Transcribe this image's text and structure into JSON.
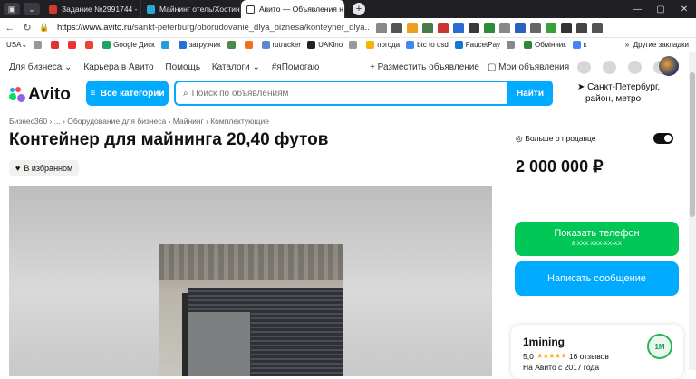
{
  "browser": {
    "tabs": [
      {
        "label": "Задание №2991744 - про",
        "color": "#d43b2a",
        "active": false
      },
      {
        "label": "Майнинг отель/Хостинг/А",
        "color": "#2aa9d4",
        "active": false
      },
      {
        "label": "Авито — Объявления н",
        "color": "#ffffff",
        "active": true
      }
    ],
    "new_tab": "+",
    "url_host": "https://www.avito.ru",
    "url_path": "/sankt-peterburg/oborudovanie_dlya_biznesa/konteyner_dlya...",
    "bookmarks": [
      "USA",
      "Google Диск",
      "загрузчик",
      "rutracker",
      "UAKino",
      "погода",
      "btc to usd",
      "FaucetPay",
      "Обмінник",
      "к"
    ],
    "bookmarks_other": "Другие закладки"
  },
  "topnav": {
    "business": "Для бизнеса",
    "career": "Карьера в Авито",
    "help": "Помощь",
    "catalogs": "Каталоги",
    "ipomogayu": "#яПомогаю",
    "post_ad": "+ Разместить объявление",
    "my_ads": "Мои объявления"
  },
  "header": {
    "logo": "Avito",
    "categories_button": "Все категории",
    "search_placeholder": "Поиск по объявлениям",
    "search_button": "Найти",
    "location_city": "Санкт-Петербург,",
    "location_sub": "район, метро"
  },
  "listing": {
    "breadcrumbs": "Бизнес360 › ... › Оборудование для бизнеса › Майнинг › Комплектующие",
    "title": "Контейнер для майнинга 20,40 футов",
    "favorite_label": "В избранном",
    "price": "2 000 000 ₽",
    "more_about_seller": "Больше о продавце",
    "show_phone": "Показать телефон",
    "phone_masked": "8 XXX XXX-XX-XX",
    "write_message": "Написать сообщение"
  },
  "seller": {
    "name": "1mining",
    "rating": "5,0",
    "stars": "★★★★★",
    "reviews": "16 отзывов",
    "since": "На Авито с 2017 года",
    "logo_text": "1M"
  },
  "colors": {
    "accent_blue": "#00aaff",
    "accent_green": "#00c755"
  }
}
